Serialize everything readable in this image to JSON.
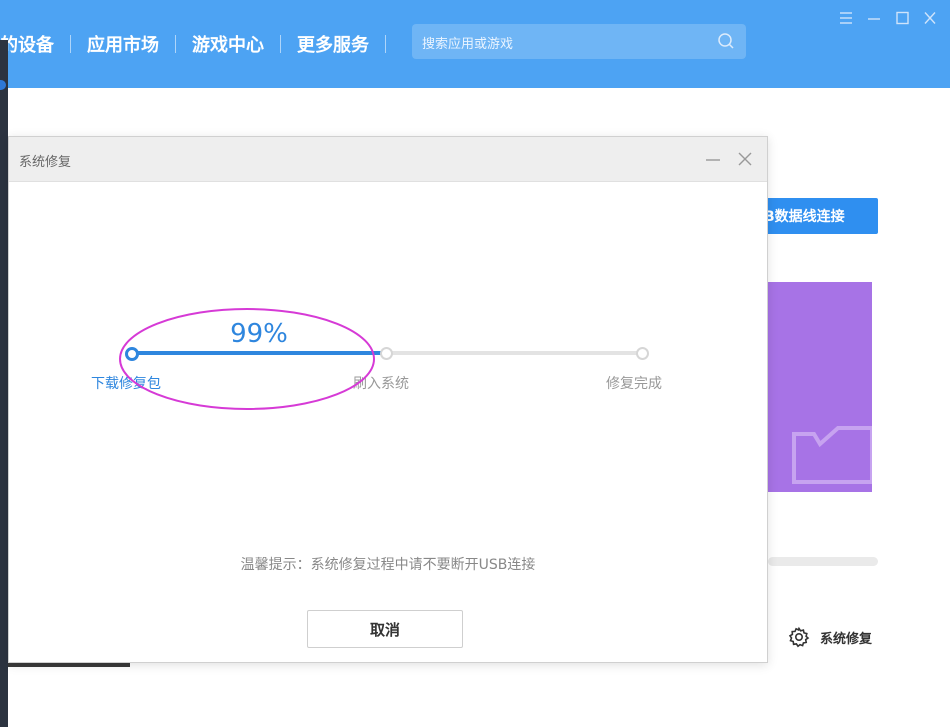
{
  "nav": {
    "items": [
      "的设备",
      "应用市场",
      "游戏中心",
      "更多服务"
    ]
  },
  "search": {
    "placeholder": "搜索应用或游戏",
    "icon": "search-icon"
  },
  "window_controls": [
    "menu-icon",
    "minimize-icon",
    "maximize-icon",
    "close-icon"
  ],
  "background_app": {
    "usb_button_label": "B数据线连接",
    "repair_label": "系统修复"
  },
  "dialog": {
    "title": "系统修复",
    "progress": {
      "percent_label": "99%",
      "fraction": 0.99,
      "steps": [
        "下载修复包",
        "刷入系统",
        "修复完成"
      ],
      "current_step": 0
    },
    "tip": "温馨提示：系统修复过程中请不要断开USB连接",
    "cancel_label": "取消"
  },
  "colors": {
    "topbar": "#4da3f3",
    "accent": "#2e86de",
    "annotation": "#d63ad6",
    "purple_card": "#a773e6"
  }
}
